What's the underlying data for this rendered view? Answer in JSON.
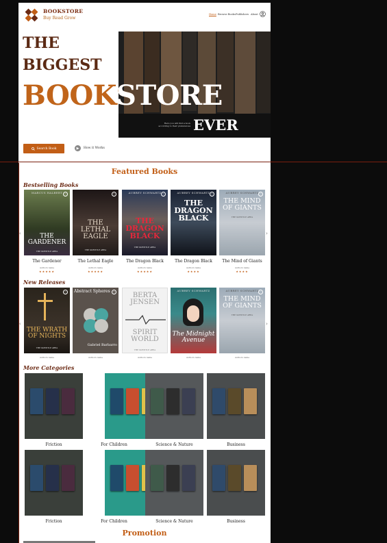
{
  "header": {
    "brand": "BOOKSTORE",
    "tagline": "Buy Read Grow",
    "nav": [
      "Home",
      "Browse Books",
      "Publishers",
      "About"
    ],
    "active_nav": "Home"
  },
  "hero": {
    "line1": "THE",
    "line2": "BIGGEST",
    "line3": "BOOKSTORE",
    "line4": "EVER",
    "caption": "Here you will find a book according to their preferences",
    "search_button": "Search Book",
    "how_button": "How it Works"
  },
  "featured": {
    "title": "Featured Books",
    "bestselling_title": "Bestselling Books",
    "bestselling": [
      {
        "title": "The Gardener",
        "author": "Authors name",
        "rating": 5,
        "cover_title": "THE GARDENER",
        "cover_author": "MARCUS HALBERT",
        "cover_sub": "THE SUBTITLE AREA"
      },
      {
        "title": "The Lethal Eagle",
        "author": "Authors name",
        "rating": 5,
        "cover_title": "THE LETHAL EAGLE",
        "cover_author": "",
        "cover_sub": "THE SUBTITLE AREA"
      },
      {
        "title": "The Dragon Black",
        "author": "Authors name",
        "rating": 5,
        "cover_title": "THE DRAGON BLACK",
        "cover_author": "AUBREY SCHWARTZ",
        "cover_sub": "THE SUBTITLE AREA"
      },
      {
        "title": "The Dragon Black",
        "author": "Authors name",
        "rating": 4,
        "cover_title": "THE DRAGON BLACK",
        "cover_author": "AUBREY SCHWARTZ",
        "cover_sub": "THE SUBTITLE AREA"
      },
      {
        "title": "The Mind of Giants",
        "author": "Authors name",
        "rating": 4,
        "cover_title": "THE MIND OF GIANTS",
        "cover_author": "AUBREY SCHWARTZ",
        "cover_sub": "THE SUBTITLE AREA"
      }
    ],
    "new_title": "New Releases",
    "new_releases": [
      {
        "author": "Authors name",
        "cover_title": "THE WRATH OF NIGHTS",
        "cover_author": "",
        "cover_sub": "THE SUBTITLE AREA"
      },
      {
        "author": "Authors name",
        "cover_title": "Abstract Spheres",
        "cover_author": "Gabriel Barbarro",
        "cover_sub": ""
      },
      {
        "author": "Authors name",
        "cover_title": "SPIRIT WORLD",
        "cover_author": "BERTA JENSEN",
        "cover_sub": "THE SUBTITLE AREA"
      },
      {
        "author": "Authors name",
        "cover_title": "The Midnight Avenue",
        "cover_author": "AUBREY SCHWARTZ",
        "cover_sub": ""
      },
      {
        "author": "Authors name",
        "cover_title": "THE MIND OF GIANTS",
        "cover_author": "AUBREY SCHWARTZ",
        "cover_sub": "THE SUBTITLE AREA"
      }
    ]
  },
  "categories": {
    "title": "More Categories",
    "items": [
      "Friction",
      "For Children",
      "Science & Nature",
      "Business",
      "Friction",
      "For Children",
      "Science & Nature",
      "Business"
    ]
  },
  "promotion": {
    "title": "Promotion"
  },
  "colors": {
    "accent": "#c25e16",
    "brown": "#6b2a14"
  },
  "icons": {
    "logo": "puzzle-logo-icon",
    "user": "user-icon",
    "search": "search-icon",
    "play": "play-icon",
    "heart": "heart-icon"
  }
}
